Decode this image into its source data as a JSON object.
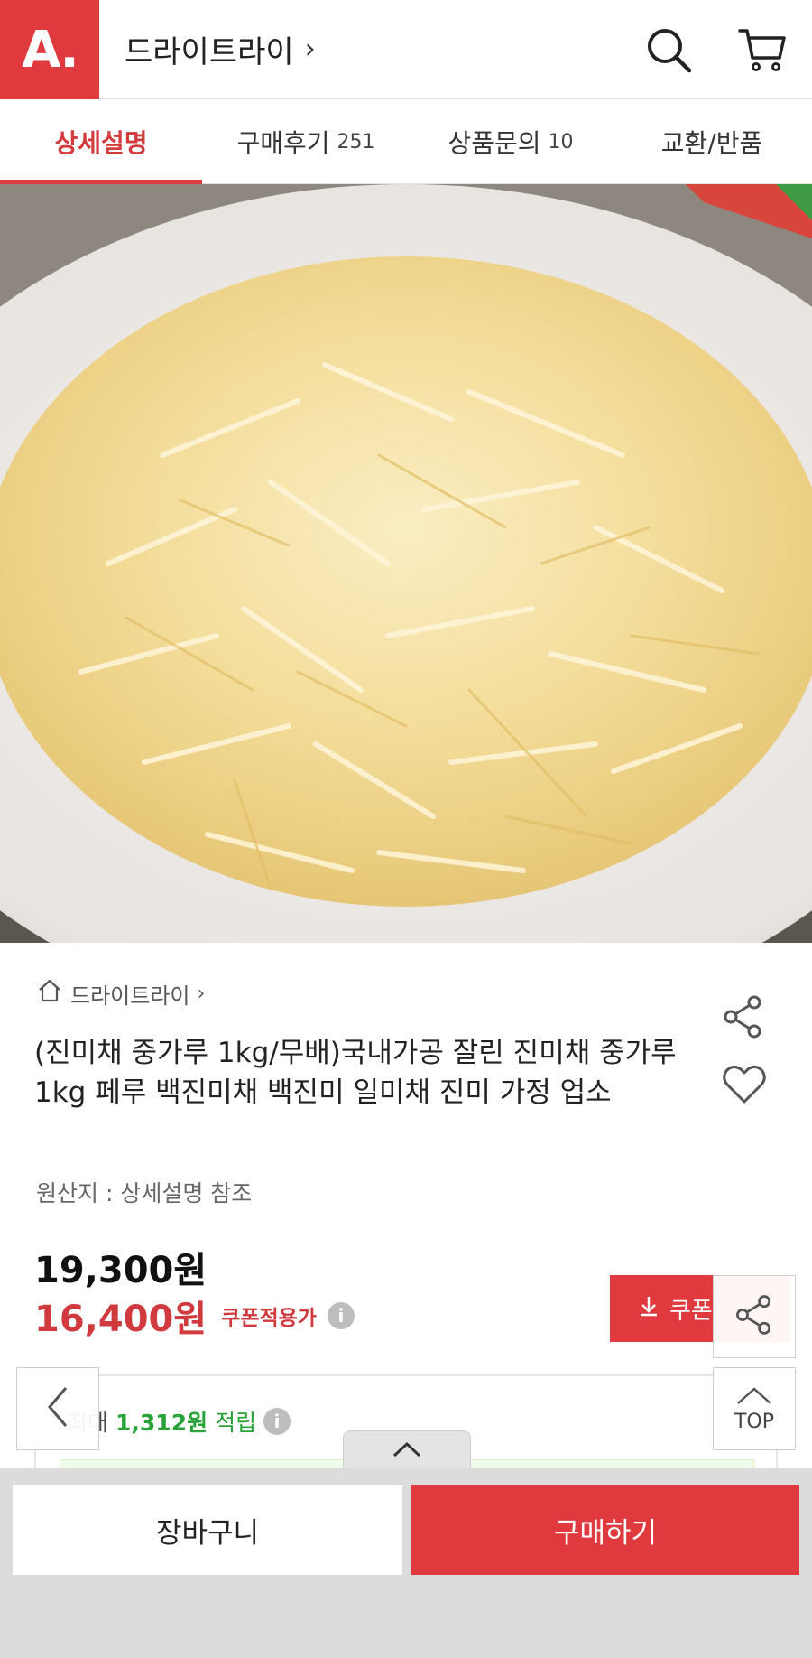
{
  "header": {
    "logo_text": "A.",
    "store_name": "드라이트라이",
    "store_chevron": "›",
    "icons": [
      "search-icon",
      "cart-icon"
    ]
  },
  "tabs": [
    {
      "label": "상세설명",
      "count": "",
      "active": true
    },
    {
      "label": "구매후기",
      "count": "251",
      "active": false
    },
    {
      "label": "상품문의",
      "count": "10",
      "active": false
    },
    {
      "label": "교환/반품",
      "count": "",
      "active": false
    }
  ],
  "product": {
    "breadcrumb_store": "드라이트라이",
    "breadcrumb_chevron": "›",
    "title": "(진미채 중가루 1kg/무배)국내가공 잘린 진미채 중가루1kg 페루 백진미채 백진미 일미채 진미 가정 업소",
    "origin": "원산지 : 상세설명 참조",
    "original_price": "19,300원",
    "sale_price": "16,400원",
    "coupon_label": "쿠폰적용가",
    "coupon_button": "쿠폰",
    "points_prefix": "최대",
    "points_amount": "1,312원",
    "points_suffix": "적립",
    "info_symbol": "i"
  },
  "floating": {
    "top_label": "TOP"
  },
  "bottom": {
    "cart_label": "장바구니",
    "buy_label": "구매하기"
  },
  "colors": {
    "accent": "#e0393e",
    "sale_red": "#d03a3e",
    "points_green": "#27a338"
  }
}
